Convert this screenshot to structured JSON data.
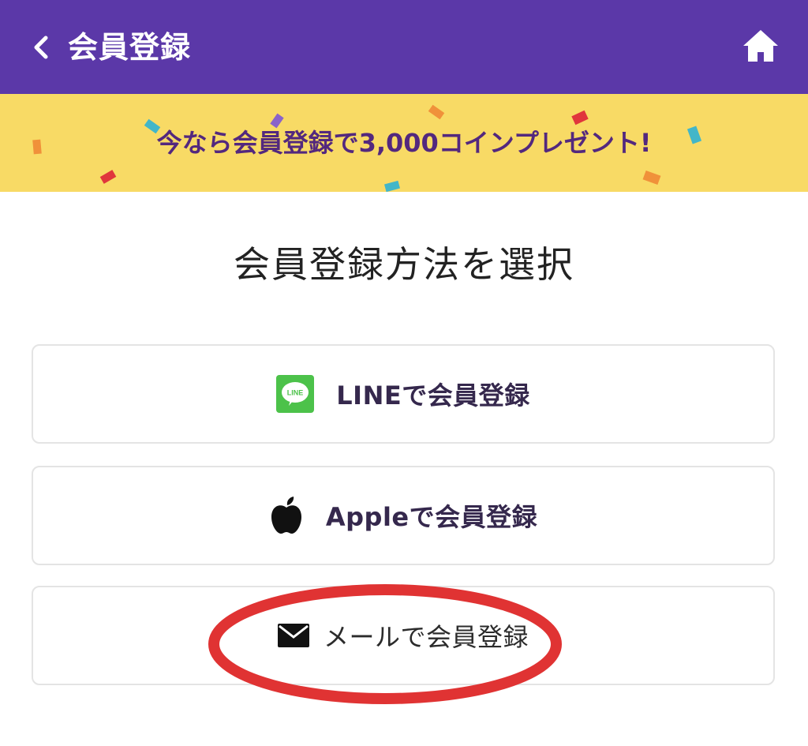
{
  "header": {
    "back_icon": "chevron-left-icon",
    "title": "会員登録",
    "home_icon": "home-icon",
    "background": "#5b38a8"
  },
  "banner": {
    "text": "今なら会員登録で3,000コインプレゼント!",
    "background": "#f8da65",
    "text_color": "#53287e"
  },
  "main": {
    "title": "会員登録方法を選択",
    "options": [
      {
        "icon": "line-icon",
        "label": "LINEで会員登録",
        "accent": "#4cc24a"
      },
      {
        "icon": "apple-icon",
        "label": "Appleで会員登録"
      },
      {
        "icon": "mail-icon",
        "label": "メールで会員登録"
      }
    ]
  },
  "annotation": {
    "shape": "red-ellipse-highlight",
    "color": "#e03333",
    "target": "メールで会員登録"
  }
}
